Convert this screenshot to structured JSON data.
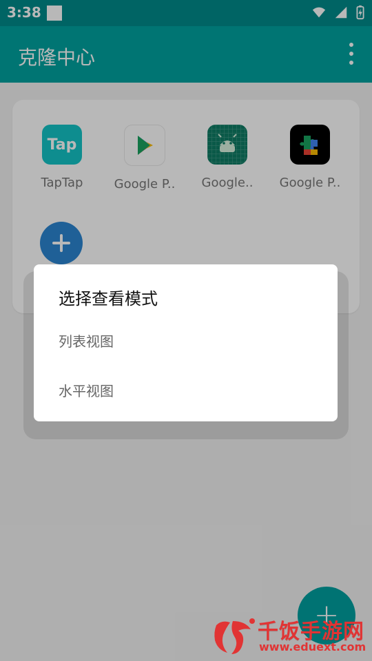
{
  "status_bar": {
    "time": "3:38"
  },
  "app_bar": {
    "title": "克隆中心"
  },
  "cloned_apps": [
    {
      "label": "TapTap",
      "icon": "taptap-icon",
      "icon_text": "Tap",
      "color": "#14c4c6"
    },
    {
      "label": "Google P..",
      "icon": "google-play-icon",
      "color": "#ffffff"
    },
    {
      "label": "Google..",
      "icon": "android-icon",
      "color": "#0f7c64"
    },
    {
      "label": "Google P..",
      "icon": "google-play-services-icon",
      "color": "#000000"
    }
  ],
  "dialog": {
    "title": "选择查看模式",
    "options": [
      "列表视图",
      "水平视图"
    ]
  },
  "watermark": {
    "brand": "千饭手游网",
    "url": "www.eduext.com"
  }
}
